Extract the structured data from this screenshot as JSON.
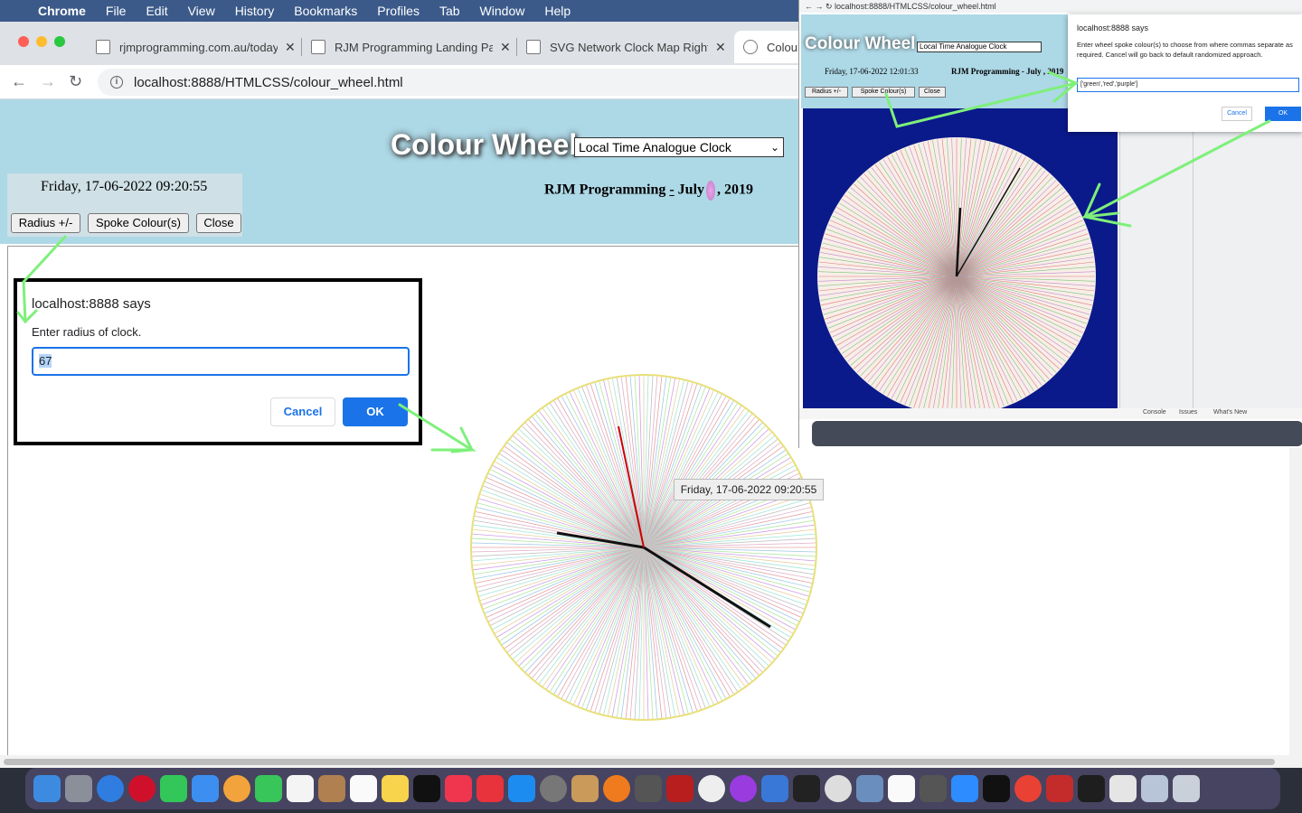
{
  "menubar": {
    "app": "Chrome",
    "items": [
      "File",
      "Edit",
      "View",
      "History",
      "Bookmarks",
      "Profiles",
      "Tab",
      "Window",
      "Help"
    ]
  },
  "tabs": [
    {
      "label": "rjmprogramming.com.au/today"
    },
    {
      "label": "RJM Programming Landing Pag"
    },
    {
      "label": "SVG Network Clock Map Right"
    },
    {
      "label": "Colour"
    }
  ],
  "address": {
    "url": "localhost:8888/HTMLCSS/colour_wheel.html"
  },
  "page": {
    "title": "Colour Wheel",
    "clock_select": "Local Time Analogue Clock",
    "rjm_text_a": "RJM Programming",
    "rjm_dash": "-",
    "rjm_text_b": "July",
    "rjm_text_c": ", 2019",
    "datetime": "Friday, 17-06-2022 09:20:55",
    "buttons": {
      "radius": "Radius +/-",
      "spoke": "Spoke Colour(s)",
      "close": "Close"
    },
    "tooltip": "Friday, 17-06-2022 09:20:55"
  },
  "dialog": {
    "heading": "localhost:8888 says",
    "message": "Enter radius of clock.",
    "value": "67",
    "cancel": "Cancel",
    "ok": "OK"
  },
  "inset": {
    "url": "localhost:8888/HTMLCSS/colour_wheel.html",
    "title": "Colour Wheel",
    "select": "Local Time Analogue Clock",
    "datetime": "Friday, 17-06-2022 12:01:33",
    "rjm": "RJM Programming - July , 2019",
    "buttons": [
      "Radius +/-",
      "Spoke Colour(s)",
      "Close"
    ],
    "dialog_heading": "localhost:8888 says",
    "dialog_message": "Enter wheel spoke colour(s) to choose from where commas separate as required. Cancel will go back to default randomized approach.",
    "dialog_value": "['green','red','purple']",
    "dialog_cancel": "Cancel",
    "dialog_ok": "OK",
    "devtools_tabs": [
      "Console",
      "Issues",
      "What's New"
    ]
  },
  "colors": {
    "page_header_bg": "#add8e6",
    "accent_blue": "#1a73e8",
    "arrow_green": "#7ef07a",
    "inset_wheel_bg": "#0a1a8a"
  }
}
